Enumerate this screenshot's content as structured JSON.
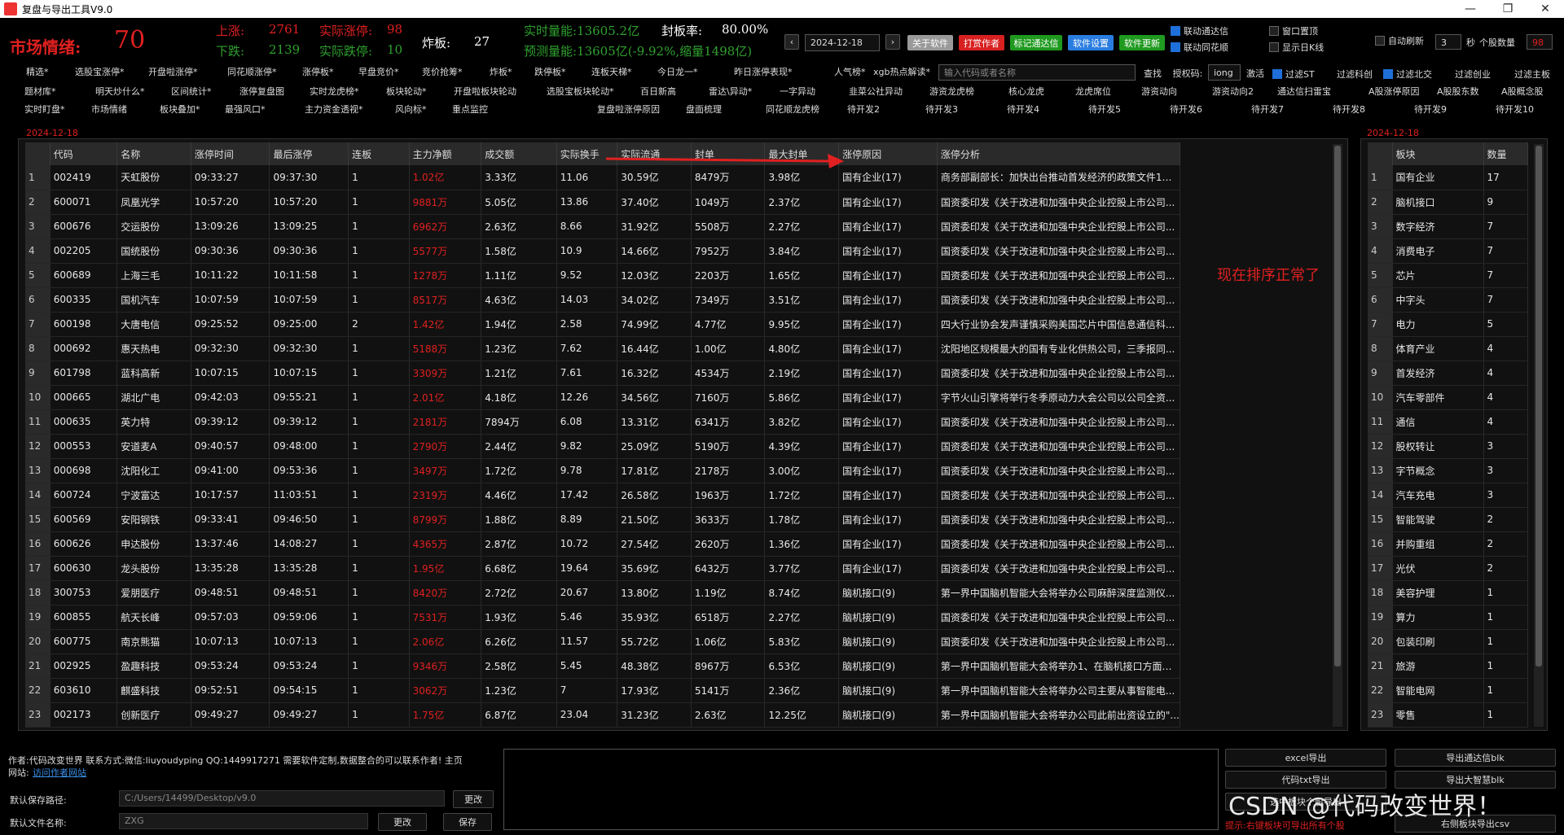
{
  "window": {
    "title": "复盘与导出工具V9.0"
  },
  "sentiment": {
    "label": "市场情绪:",
    "value": "70"
  },
  "stats": {
    "up_label": "上涨:",
    "up_value": "2761",
    "real_limit_up_label": "实际涨停:",
    "real_limit_up_value": "98",
    "down_label": "下跌:",
    "down_value": "2139",
    "real_limit_down_label": "实际跌停:",
    "real_limit_down_value": "10",
    "broken_label": "炸板:",
    "broken_value": "27",
    "volume_line": "实时量能:13605.2亿",
    "forecast_line": "预测量能:13605亿(-9.92%,缩量1498亿)",
    "seal_rate_label": "封板率:",
    "seal_rate_value": "80.00%"
  },
  "date": {
    "value": "2024-12-18",
    "prev": "‹",
    "next": "›"
  },
  "top_buttons": {
    "about": "关于软件",
    "reward": "打赏作者",
    "mark_tdx": "标记通达信",
    "settings": "软件设置",
    "update": "软件更新"
  },
  "top_checks": {
    "link_tdx": "联动通达信",
    "link_ths": "联动同花顺",
    "pin_window": "窗口置顶",
    "show_day_k": "显示日K线"
  },
  "auto_refresh": {
    "label": "自动刷新",
    "value": "3",
    "unit": "秒",
    "stock_count_label": "个股数量",
    "stock_count_value": "98"
  },
  "toolbar1": [
    "精选*",
    "选股宝涨停*",
    "开盘啦涨停*",
    "同花顺涨停*",
    "涨停板*",
    "早盘竞价*",
    "竞价抢筹*",
    "炸板*",
    "跌停板*",
    "连板天梯*",
    "今日龙一*",
    "昨日涨停表现*",
    "人气榜*",
    "xgb热点解读*"
  ],
  "search": {
    "placeholder": "输入代码或者名称",
    "button": "查找",
    "auth_label": "授权码:",
    "auth_value": "iong",
    "activate": "激活"
  },
  "filters": [
    "过滤ST",
    "过滤科创",
    "过滤北交",
    "过滤创业",
    "过滤主板"
  ],
  "toolbar2": [
    "题材库*",
    "明天炒什么*",
    "区间统计*",
    "涨停复盘图",
    "实时龙虎榜*",
    "板块轮动*",
    "开盘啦板块轮动",
    "选股宝板块轮动*",
    "百日新高",
    "雷达\\异动*",
    "一字异动",
    "韭菜公社异动",
    "游资龙虎榜",
    "核心龙虎",
    "龙虎席位",
    "游资动向",
    "游资动向2",
    "通达信扫雷宝",
    "A股涨停原因",
    "A股股东数",
    "A股概念股"
  ],
  "toolbar3": [
    "实时盯盘*",
    "市场情绪",
    "板块叠加*",
    "最强风口*",
    "主力资金透视*",
    "风向标*",
    "重点监控",
    "复盘啦涨停原因",
    "盘面梳理",
    "同花顺龙虎榜",
    "待开发2",
    "待开发3",
    "待开发4",
    "待开发5",
    "待开发6",
    "待开发7",
    "待开发8",
    "待开发9",
    "待开发10"
  ],
  "main_table": {
    "date_label": "2024-12-18",
    "columns": [
      "",
      "代码",
      "名称",
      "涨停时间",
      "最后涨停",
      "连板",
      "主力净额",
      "成交额",
      "实际换手",
      "实际流通",
      "封单",
      "最大封单",
      "涨停原因",
      "涨停分析"
    ],
    "rows": [
      [
        "1",
        "002419",
        "天虹股份",
        "09:33:27",
        "09:37:30",
        "1",
        "1.02亿",
        "3.33亿",
        "11.06",
        "30.59亿",
        "8479万",
        "3.98亿",
        "国有企业(17)",
        "商务部副部长：加快出台推动首发经济的政策文件1、..."
      ],
      [
        "2",
        "600071",
        "凤凰光学",
        "10:57:20",
        "10:57:20",
        "1",
        "9881万",
        "5.05亿",
        "13.86",
        "37.40亿",
        "1049万",
        "2.37亿",
        "国有企业(17)",
        "国资委印发《关于改进和加强中央企业控股上市公司..."
      ],
      [
        "3",
        "600676",
        "交运股份",
        "13:09:26",
        "13:09:25",
        "1",
        "6962万",
        "2.63亿",
        "8.66",
        "31.92亿",
        "5508万",
        "2.27亿",
        "国有企业(17)",
        "国资委印发《关于改进和加强中央企业控股上市公司..."
      ],
      [
        "4",
        "002205",
        "国统股份",
        "09:30:36",
        "09:30:36",
        "1",
        "5577万",
        "1.58亿",
        "10.9",
        "14.66亿",
        "7952万",
        "3.84亿",
        "国有企业(17)",
        "国资委印发《关于改进和加强中央企业控股上市公司..."
      ],
      [
        "5",
        "600689",
        "上海三毛",
        "10:11:22",
        "10:11:58",
        "1",
        "1278万",
        "1.11亿",
        "9.52",
        "12.03亿",
        "2203万",
        "1.65亿",
        "国有企业(17)",
        "国资委印发《关于改进和加强中央企业控股上市公司..."
      ],
      [
        "6",
        "600335",
        "国机汽车",
        "10:07:59",
        "10:07:59",
        "1",
        "8517万",
        "4.63亿",
        "14.03",
        "34.02亿",
        "7349万",
        "3.51亿",
        "国有企业(17)",
        "国资委印发《关于改进和加强中央企业控股上市公司..."
      ],
      [
        "7",
        "600198",
        "大唐电信",
        "09:25:52",
        "09:25:00",
        "2",
        "1.42亿",
        "1.94亿",
        "2.58",
        "74.99亿",
        "4.77亿",
        "9.95亿",
        "国有企业(17)",
        "四大行业协会发声谨慎采购美国芯片中国信息通信科..."
      ],
      [
        "8",
        "000692",
        "惠天热电",
        "09:32:30",
        "09:32:30",
        "1",
        "5188万",
        "1.23亿",
        "7.62",
        "16.44亿",
        "1.00亿",
        "4.80亿",
        "国有企业(17)",
        "沈阳地区规模最大的国有专业化供热公司，三季报同..."
      ],
      [
        "9",
        "601798",
        "蓝科高新",
        "10:07:15",
        "10:07:15",
        "1",
        "3309万",
        "1.21亿",
        "7.61",
        "16.32亿",
        "4534万",
        "2.19亿",
        "国有企业(17)",
        "国资委印发《关于改进和加强中央企业控股上市公司..."
      ],
      [
        "10",
        "000665",
        "湖北广电",
        "09:42:03",
        "09:55:21",
        "1",
        "2.01亿",
        "4.18亿",
        "12.26",
        "34.56亿",
        "7160万",
        "5.86亿",
        "国有企业(17)",
        "字节火山引擎将举行冬季原动力大会公司以公司全资..."
      ],
      [
        "11",
        "000635",
        "英力特",
        "09:39:12",
        "09:39:12",
        "1",
        "2181万",
        "7894万",
        "6.08",
        "13.31亿",
        "6341万",
        "3.82亿",
        "国有企业(17)",
        "国资委印发《关于改进和加强中央企业控股上市公司..."
      ],
      [
        "12",
        "000553",
        "安道麦A",
        "09:40:57",
        "09:48:00",
        "1",
        "2790万",
        "2.44亿",
        "9.82",
        "25.09亿",
        "5190万",
        "4.39亿",
        "国有企业(17)",
        "国资委印发《关于改进和加强中央企业控股上市公司..."
      ],
      [
        "13",
        "000698",
        "沈阳化工",
        "09:41:00",
        "09:53:36",
        "1",
        "3497万",
        "1.72亿",
        "9.78",
        "17.81亿",
        "2178万",
        "3.00亿",
        "国有企业(17)",
        "国资委印发《关于改进和加强中央企业控股上市公司..."
      ],
      [
        "14",
        "600724",
        "宁波富达",
        "10:17:57",
        "11:03:51",
        "1",
        "2319万",
        "4.46亿",
        "17.42",
        "26.58亿",
        "1963万",
        "1.72亿",
        "国有企业(17)",
        "国资委印发《关于改进和加强中央企业控股上市公司..."
      ],
      [
        "15",
        "600569",
        "安阳钢铁",
        "09:33:41",
        "09:46:50",
        "1",
        "8799万",
        "1.88亿",
        "8.89",
        "21.50亿",
        "3633万",
        "1.78亿",
        "国有企业(17)",
        "国资委印发《关于改进和加强中央企业控股上市公司..."
      ],
      [
        "16",
        "600626",
        "申达股份",
        "13:37:46",
        "14:08:27",
        "1",
        "4365万",
        "2.87亿",
        "10.72",
        "27.54亿",
        "2620万",
        "1.36亿",
        "国有企业(17)",
        "国资委印发《关于改进和加强中央企业控股上市公司..."
      ],
      [
        "17",
        "600630",
        "龙头股份",
        "13:35:28",
        "13:35:28",
        "1",
        "1.95亿",
        "6.68亿",
        "19.64",
        "35.69亿",
        "6432万",
        "3.77亿",
        "国有企业(17)",
        "国资委印发《关于改进和加强中央企业控股上市公司..."
      ],
      [
        "18",
        "300753",
        "爱朋医疗",
        "09:48:51",
        "09:48:51",
        "1",
        "8420万",
        "2.72亿",
        "20.67",
        "13.80亿",
        "1.19亿",
        "8.74亿",
        "脑机接口(9)",
        "第一界中国脑机智能大会将举办公司麻醉深度监测仪..."
      ],
      [
        "19",
        "600855",
        "航天长峰",
        "09:57:03",
        "09:59:06",
        "1",
        "7531万",
        "1.93亿",
        "5.46",
        "35.93亿",
        "6518万",
        "2.27亿",
        "脑机接口(9)",
        "国资委印发《关于改进和加强中央企业控股上市公司..."
      ],
      [
        "20",
        "600775",
        "南京熊猫",
        "10:07:13",
        "10:07:13",
        "1",
        "2.06亿",
        "6.26亿",
        "11.57",
        "55.72亿",
        "1.06亿",
        "5.83亿",
        "脑机接口(9)",
        "国资委印发《关于改进和加强中央企业控股上市公司..."
      ],
      [
        "21",
        "002925",
        "盈趣科技",
        "09:53:24",
        "09:53:24",
        "1",
        "9346万",
        "2.58亿",
        "5.45",
        "48.38亿",
        "8967万",
        "6.53亿",
        "脑机接口(9)",
        "第一界中国脑机智能大会将举办1、在脑机接口方面，..."
      ],
      [
        "22",
        "603610",
        "麒盛科技",
        "09:52:51",
        "09:54:15",
        "1",
        "3062万",
        "1.23亿",
        "7",
        "17.93亿",
        "5141万",
        "2.36亿",
        "脑机接口(9)",
        "第一界中国脑机智能大会将举办公司主要从事智能电..."
      ],
      [
        "23",
        "002173",
        "创新医疗",
        "09:49:27",
        "09:49:27",
        "1",
        "1.75亿",
        "6.87亿",
        "23.04",
        "31.23亿",
        "2.63亿",
        "12.25亿",
        "脑机接口(9)",
        "第一界中国脑机智能大会将举办公司此前出资设立的\"..."
      ]
    ]
  },
  "annotation": {
    "text": "现在排序正常了"
  },
  "side_table": {
    "date_label": "2024-12-18",
    "columns": [
      "",
      "板块",
      "数量"
    ],
    "rows": [
      [
        "1",
        "国有企业",
        "17"
      ],
      [
        "2",
        "脑机接口",
        "9"
      ],
      [
        "3",
        "数字经济",
        "7"
      ],
      [
        "4",
        "消费电子",
        "7"
      ],
      [
        "5",
        "芯片",
        "7"
      ],
      [
        "6",
        "中字头",
        "7"
      ],
      [
        "7",
        "电力",
        "5"
      ],
      [
        "8",
        "体育产业",
        "4"
      ],
      [
        "9",
        "首发经济",
        "4"
      ],
      [
        "10",
        "汽车零部件",
        "4"
      ],
      [
        "11",
        "通信",
        "4"
      ],
      [
        "12",
        "股权转让",
        "3"
      ],
      [
        "13",
        "字节概念",
        "3"
      ],
      [
        "14",
        "汽车充电",
        "3"
      ],
      [
        "15",
        "智能驾驶",
        "2"
      ],
      [
        "16",
        "并购重组",
        "2"
      ],
      [
        "17",
        "光伏",
        "2"
      ],
      [
        "18",
        "美容护理",
        "1"
      ],
      [
        "19",
        "算力",
        "1"
      ],
      [
        "20",
        "包装印刷",
        "1"
      ],
      [
        "21",
        "旅游",
        "1"
      ],
      [
        "22",
        "智能电网",
        "1"
      ],
      [
        "23",
        "零售",
        "1"
      ]
    ]
  },
  "footer": {
    "author_line": "作者:代码改变世界 联系方式:微信:liuyoudyping QQ:1449917271 需要软件定制,数据整合的可以联系作者! 主页",
    "site_label": "网站:",
    "site_link": "访问作者网站",
    "save_path_label": "默认保存路径:",
    "save_path_value": "C:/Users/14499/Desktop/v9.0",
    "change1": "更改",
    "file_name_label": "默认文件名称:",
    "file_name_value": "ZXG",
    "change2": "更改",
    "save": "保存",
    "export_buttons": [
      "excel导出",
      "导出通达信blk",
      "代码txt导出",
      "导出大智慧blk",
      "选中板块个股导出",
      "右侧板块导出csv"
    ],
    "tip": "提示:右键板块可导出所有个股",
    "watermark": "CSDN @代码改变世界！"
  }
}
